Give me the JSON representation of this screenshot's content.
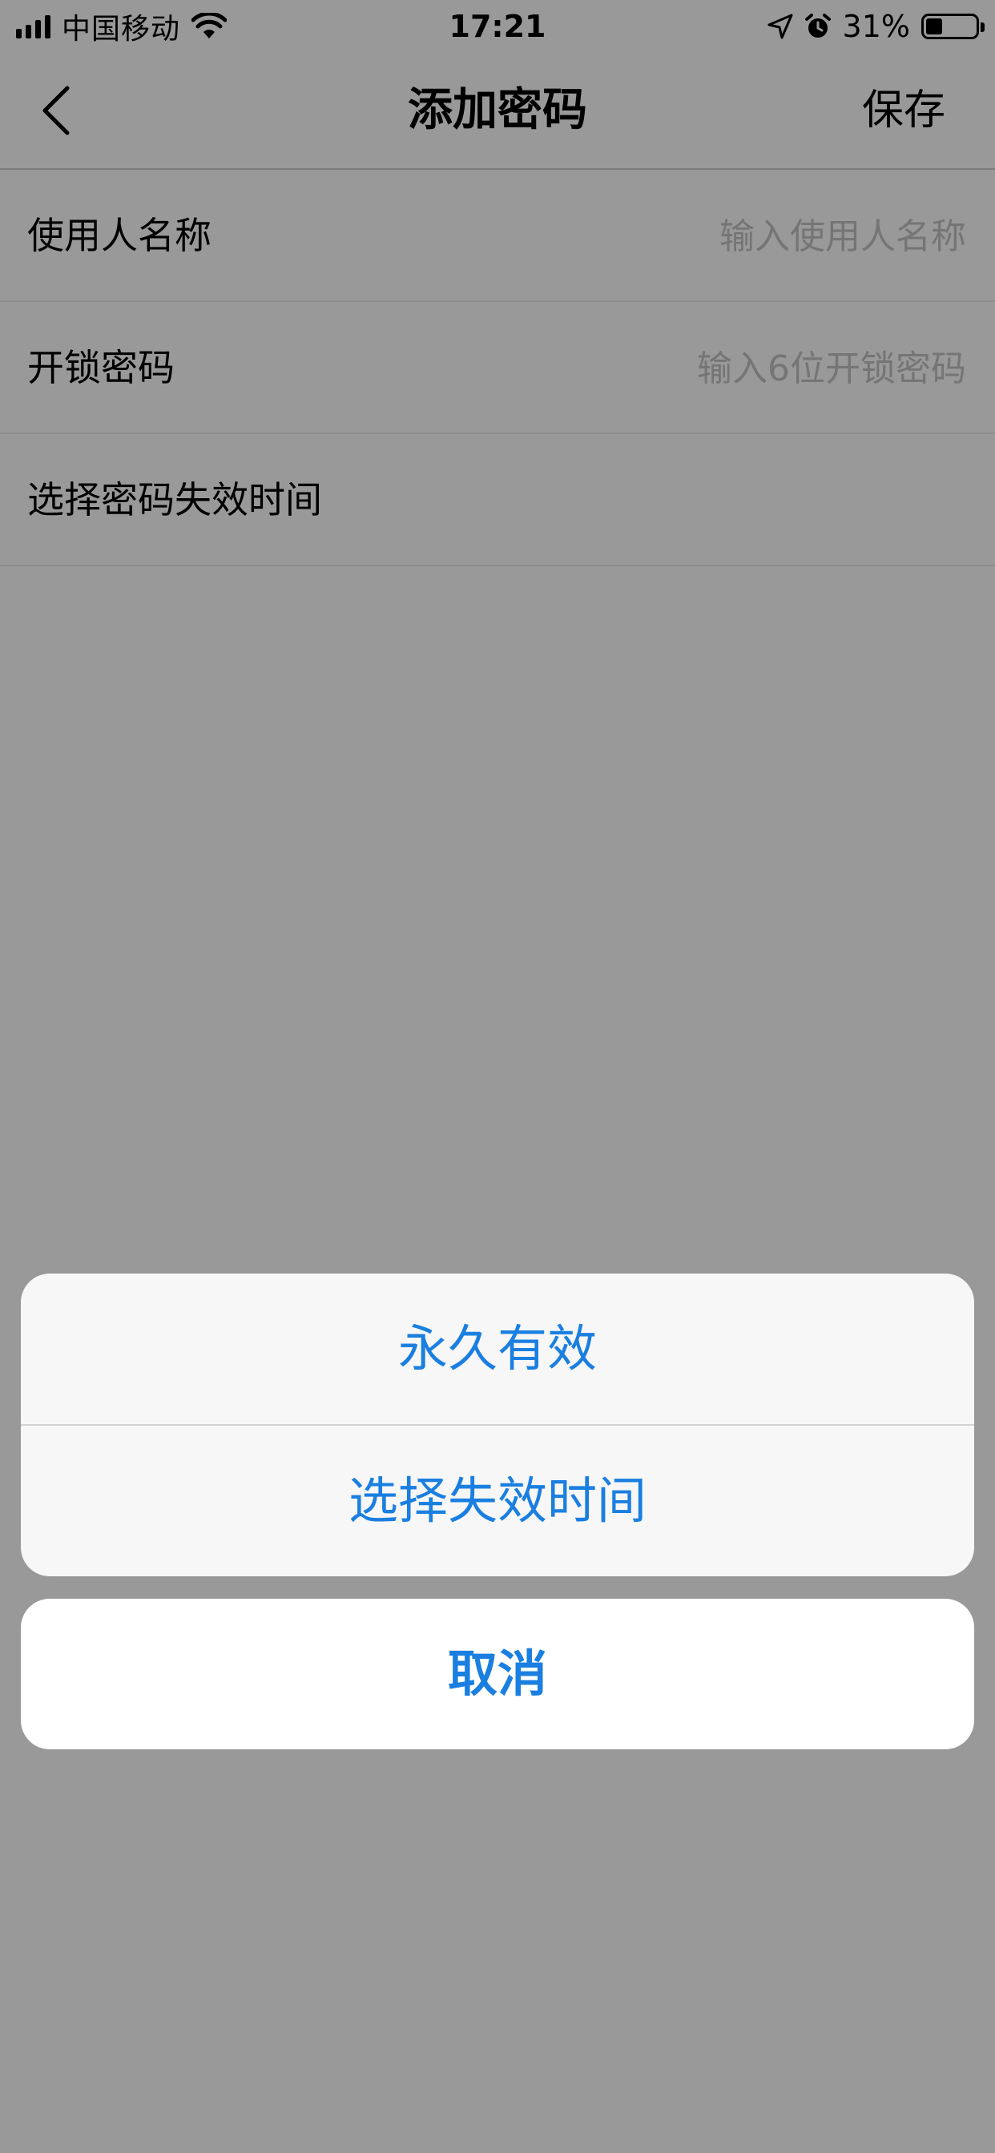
{
  "status_bar": {
    "carrier": "中国移动",
    "time": "17:21",
    "battery": "31%",
    "icons": [
      "signal-icon",
      "wifi-icon",
      "location-icon",
      "alarm-icon",
      "battery-icon"
    ]
  },
  "nav": {
    "title": "添加密码",
    "save_label": "保存",
    "back_icon": "chevron-left-icon"
  },
  "form": {
    "rows": [
      {
        "label": "使用人名称",
        "placeholder": "输入使用人名称"
      },
      {
        "label": "开锁密码",
        "placeholder": "输入6位开锁密码"
      },
      {
        "label": "选择密码失效时间"
      }
    ]
  },
  "action_sheet": {
    "options": [
      {
        "label": "永久有效"
      },
      {
        "label": "选择失效时间"
      }
    ],
    "cancel_label": "取消",
    "accent_color": "#1a7fe0"
  }
}
